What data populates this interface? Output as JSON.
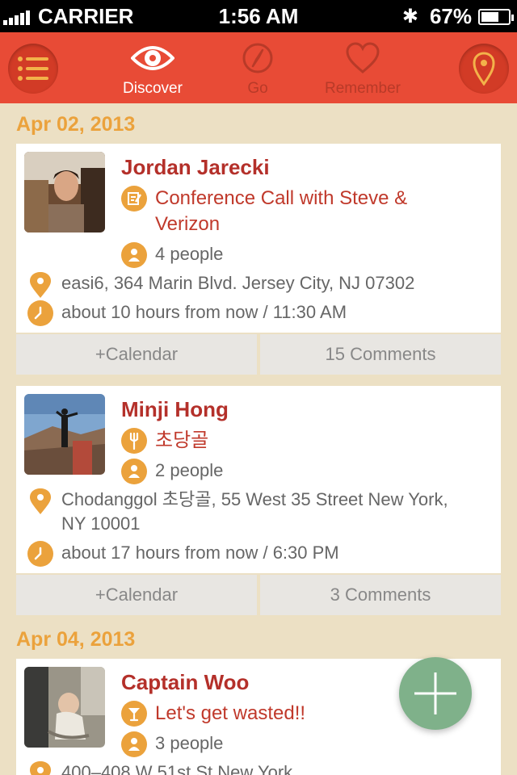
{
  "status_bar": {
    "carrier": "CARRIER",
    "time": "1:56 AM",
    "battery": "67%",
    "battery_level": 0.67
  },
  "nav": {
    "tabs": [
      {
        "label": "Discover",
        "icon": "eye-icon",
        "active": true
      },
      {
        "label": "Go",
        "icon": "compass-icon",
        "active": false
      },
      {
        "label": "Remember",
        "icon": "heart-icon",
        "active": false
      }
    ],
    "left_icon": "list-icon",
    "right_icon": "map-pin-icon"
  },
  "colors": {
    "nav_bg": "#e84b36",
    "accent": "#eba23c",
    "name": "#b4302a",
    "fab": "#7fb18a",
    "background": "#ece0c4"
  },
  "sections": [
    {
      "date": "Apr 02, 2013",
      "events": [
        {
          "name": "Jordan Jarecki",
          "title_line1": "Conference Call with Steve &",
          "title_line2": "Verizon",
          "type_icon": "notepad-icon",
          "people": "4 people",
          "location": "easi6, 364 Marin Blvd. Jersey City, NJ 07302",
          "time": "about 10 hours from now / 11:30 AM",
          "calendar_label": "+Calendar",
          "comments_label": "15 Comments"
        }
      ]
    },
    {
      "date": "",
      "events": [
        {
          "name": "Minji Hong",
          "title_line1": "초당골",
          "type_icon": "fork-icon",
          "people": "2 people",
          "location_line1": "Chodanggol 초당골, 55 West 35 Street New York,",
          "location_line2": "NY 10001",
          "time": "about 17 hours from now / 6:30 PM",
          "calendar_label": "+Calendar",
          "comments_label": "3 Comments"
        }
      ]
    },
    {
      "date": "Apr 04, 2013",
      "events": [
        {
          "name": "Captain Woo",
          "title_line1": "Let's get wasted!!",
          "type_icon": "cocktail-icon",
          "people": "3 people",
          "location": "400–408 W 51st St New York"
        }
      ]
    }
  ],
  "fab_icon": "plus-icon"
}
